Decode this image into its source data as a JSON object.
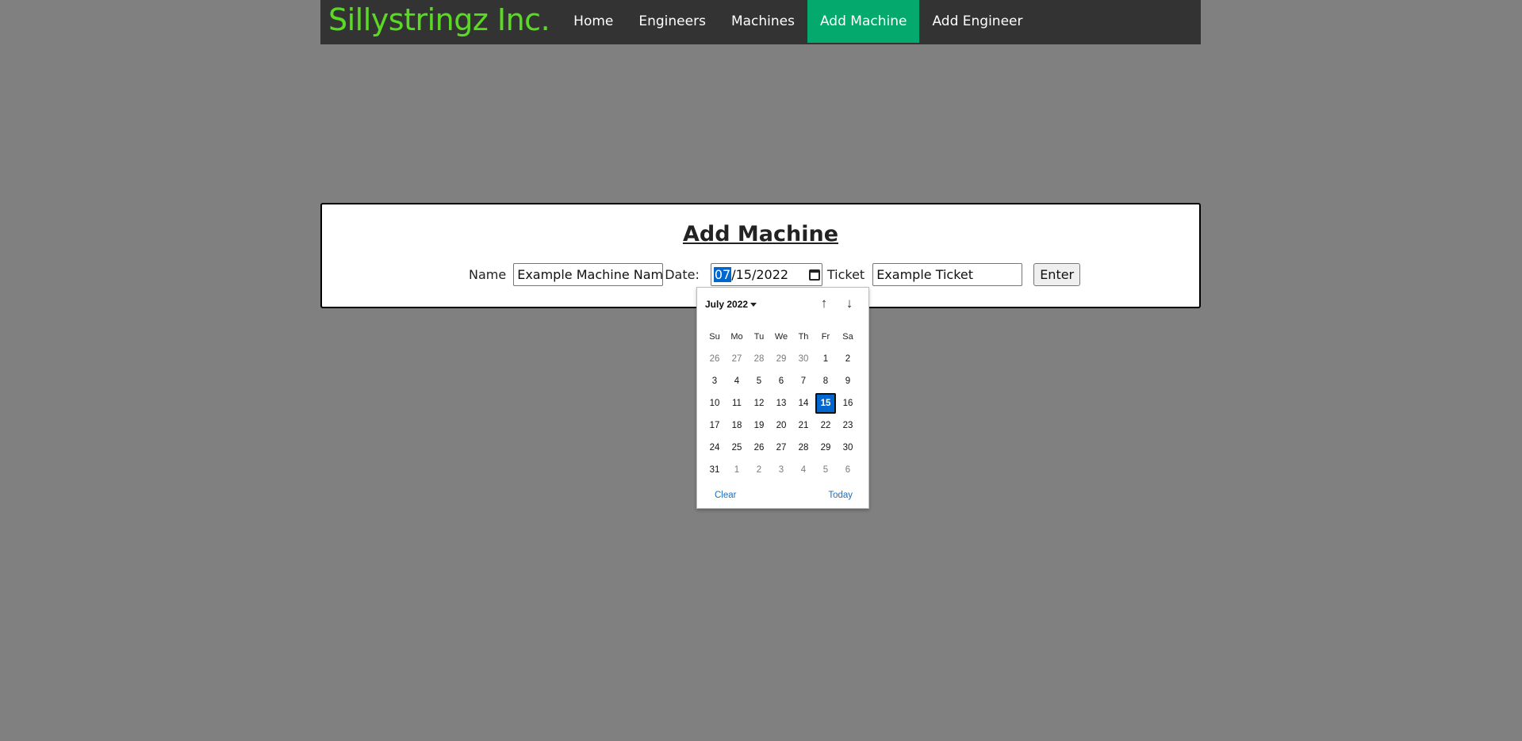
{
  "nav": {
    "brand": "Sillystringz Inc.",
    "links": [
      {
        "label": "Home",
        "active": false
      },
      {
        "label": "Engineers",
        "active": false
      },
      {
        "label": "Machines",
        "active": false
      },
      {
        "label": "Add Machine",
        "active": true
      },
      {
        "label": "Add Engineer",
        "active": false
      }
    ]
  },
  "form": {
    "title": "Add Machine",
    "name_label": "Name",
    "name_value": "Example Machine Name",
    "date_label": "Date:",
    "date_month": "07",
    "date_rest": "/15/2022",
    "ticket_label": "Ticket",
    "ticket_value": "Example Ticket",
    "submit_label": "Enter"
  },
  "datepicker": {
    "month_label": "July 2022",
    "up_arrow": "↑",
    "down_arrow": "↓",
    "weekdays": [
      "Su",
      "Mo",
      "Tu",
      "We",
      "Th",
      "Fr",
      "Sa"
    ],
    "weeks": [
      [
        "26",
        "27",
        "28",
        "29",
        "30",
        "1",
        "2"
      ],
      [
        "3",
        "4",
        "5",
        "6",
        "7",
        "8",
        "9"
      ],
      [
        "10",
        "11",
        "12",
        "13",
        "14",
        "15",
        "16"
      ],
      [
        "17",
        "18",
        "19",
        "20",
        "21",
        "22",
        "23"
      ],
      [
        "24",
        "25",
        "26",
        "27",
        "28",
        "29",
        "30"
      ],
      [
        "31",
        "1",
        "2",
        "3",
        "4",
        "5",
        "6"
      ]
    ],
    "selected_day": "15",
    "clear_label": "Clear",
    "today_label": "Today"
  },
  "colors": {
    "brand": "#5cd826",
    "nav_bg": "#333333",
    "nav_active": "#04aa6d",
    "page_bg": "#808080",
    "selection": "#0067cf"
  }
}
